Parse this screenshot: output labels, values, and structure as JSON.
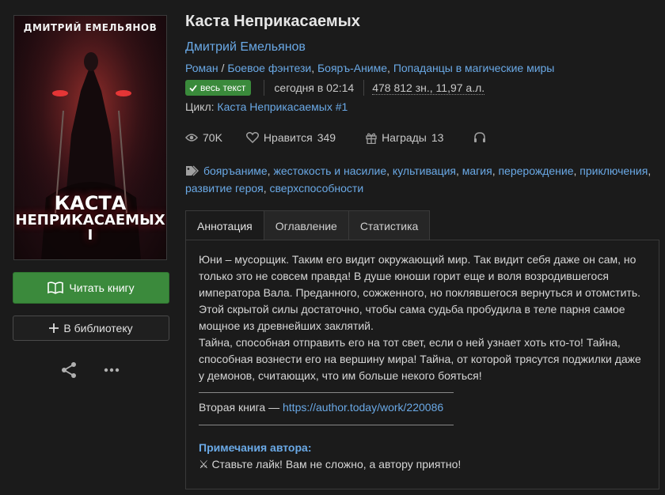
{
  "cover": {
    "author": "ДМИТРИЙ ЕМЕЛЬЯНОВ",
    "title_line1": "КАСТА",
    "title_line2": "НЕПРИКАСАЕМЫХ I"
  },
  "actions": {
    "read": "Читать книгу",
    "library": "В библиотеку"
  },
  "book": {
    "title": "Каста Неприкасаемых",
    "author": "Дмитрий Емельянов",
    "genres": [
      "Роман",
      "Боевое фэнтези",
      "Бояръ-Аниме",
      "Попаданцы в магические миры"
    ],
    "genre_sep": " / ",
    "status": "весь текст",
    "updated": "сегодня в 02:14",
    "size": "478 812 зн., 11,97 а.л.",
    "cycle_label": "Цикл:",
    "cycle": "Каста Неприкасаемых #1"
  },
  "stats": {
    "views": "70K",
    "likes_label": "Нравится",
    "likes": "349",
    "awards_label": "Награды",
    "awards": "13"
  },
  "tags": [
    "бояръаниме",
    "жестокость и насилие",
    "культивация",
    "магия",
    "перерождение",
    "приключения",
    "развитие героя",
    "сверхспособности"
  ],
  "tabs": [
    "Аннотация",
    "Оглавление",
    "Статистика"
  ],
  "annotation": {
    "p1": "Юни – мусорщик. Таким его видит окружающий мир. Так видит себя даже он сам, но только это не совсем правда! В душе юноши горит еще и воля возродившегося императора Вала. Преданного, сожженного, но поклявшегося вернуться и отомстить. Этой скрытой силы достаточно, чтобы сама судьба пробудила в теле парня самое мощное из древнейших заклятий.",
    "p2": "Тайна, способная отправить его на тот свет, если о ней узнает хоть кто-то! Тайна, способная вознести его на вершину мира! Тайна, от которой трясутся поджилки даже у демонов, считающих, что им больше некого бояться!",
    "second_book_label": "Вторая книга —",
    "second_book_link": "https://author.today/work/220086",
    "notes_title": "Примечания автора:",
    "notes_text": "⚔ Ставьте лайк! Вам не сложно, а автору приятно!"
  },
  "colors": {
    "background": "#1b1b1b",
    "link": "#6aa9e6",
    "accent_green": "#3b8a3c"
  }
}
